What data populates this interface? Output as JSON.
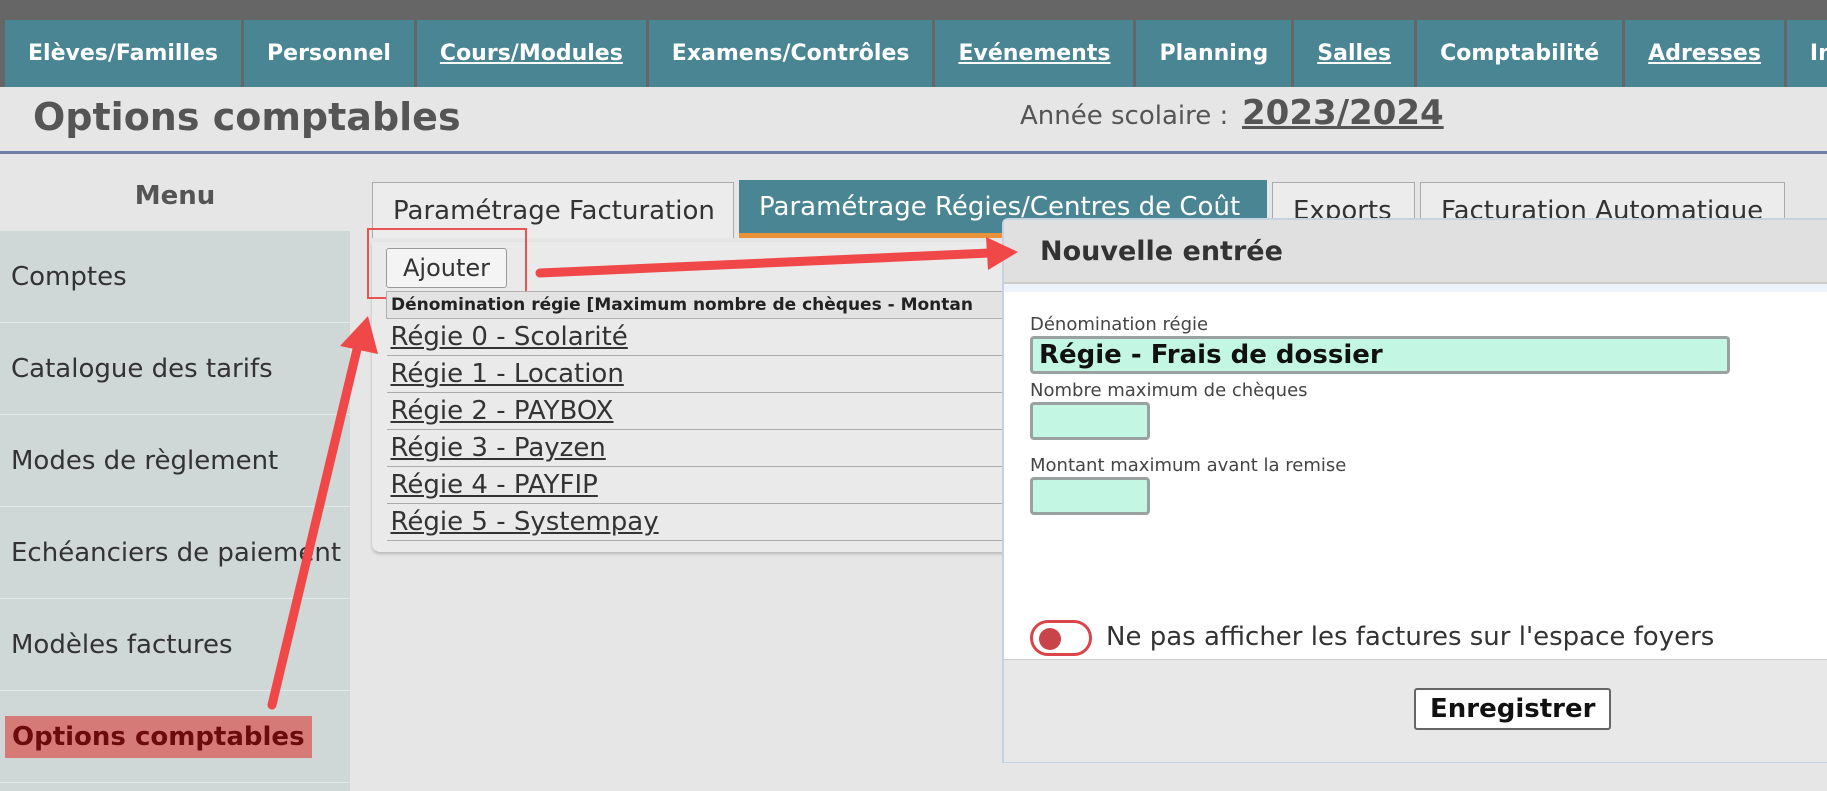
{
  "nav": {
    "items": [
      {
        "label": "Elèves/Familles",
        "link": false
      },
      {
        "label": "Personnel",
        "link": false
      },
      {
        "label": "Cours/Modules",
        "link": true
      },
      {
        "label": "Examens/Contrôles",
        "link": false
      },
      {
        "label": "Evénements",
        "link": true
      },
      {
        "label": "Planning",
        "link": false
      },
      {
        "label": "Salles",
        "link": true
      },
      {
        "label": "Comptabilité",
        "link": false
      },
      {
        "label": "Adresses",
        "link": true
      },
      {
        "label": "Invent",
        "link": false
      }
    ]
  },
  "header": {
    "title": "Options comptables",
    "year_label": "Année scolaire :",
    "year_value": "2023/2024"
  },
  "sidebar": {
    "title": "Menu",
    "items": [
      {
        "label": "Comptes",
        "active": false
      },
      {
        "label": "Catalogue des tarifs",
        "active": false
      },
      {
        "label": "Modes de règlement",
        "active": false
      },
      {
        "label": "Echéanciers de paiement",
        "active": false
      },
      {
        "label": "Modèles factures",
        "active": false
      },
      {
        "label": "Options comptables",
        "active": true
      }
    ]
  },
  "tabs": [
    {
      "label": "Paramétrage Facturation",
      "active": false
    },
    {
      "label": "Paramétrage Régies/Centres de Coût",
      "active": true
    },
    {
      "label": "Exports",
      "active": false
    },
    {
      "label": "Facturation Automatique",
      "active": false
    }
  ],
  "panel": {
    "add_label": "Ajouter",
    "table_header": "Dénomination régie [Maximum nombre de chèques - Montan",
    "rows": [
      "Régie 0 - Scolarité",
      "Régie 1 - Location",
      "Régie 2 - PAYBOX",
      "Régie 3 - Payzen",
      "Régie 4 - PAYFIP",
      "Régie 5 - Systempay"
    ]
  },
  "dialog": {
    "title": "Nouvelle entrée",
    "name_label": "Dénomination régie",
    "name_value": "Régie - Frais de dossier",
    "max_cheques_label": "Nombre maximum de chèques",
    "max_cheques_value": "",
    "max_amount_label": "Montant maximum avant la remise",
    "max_amount_value": "",
    "toggle_label": "Ne pas afficher les factures sur l'espace foyers",
    "toggle_on": false,
    "save_label": "Enregistrer"
  },
  "colors": {
    "nav_bg": "#4a8593",
    "active_tab_underline": "#e8923a",
    "active_menu_bg": "#d67a78",
    "input_bg": "#c3f7e4",
    "annotation_red": "#f04848"
  }
}
